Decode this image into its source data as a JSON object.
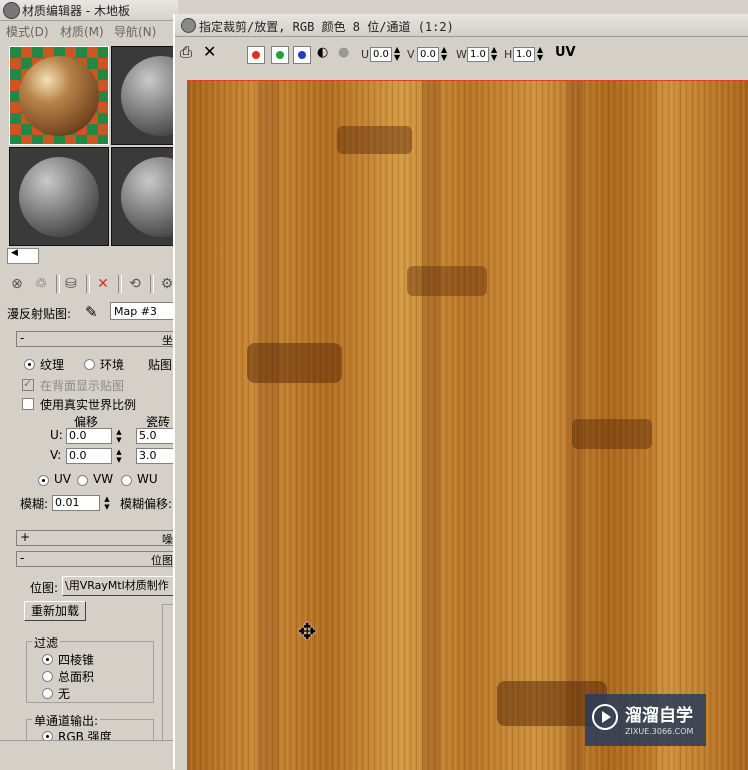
{
  "material_editor": {
    "title": "材质编辑器 - 木地板",
    "menu": [
      "模式(D)",
      "材质(M)",
      "导航(N)"
    ],
    "diffuse_label": "漫反射贴图:",
    "map_name": "Map #3",
    "coords_rollup_sign": "-",
    "coords_rollup_right": "坐",
    "radio_texture": "纹理",
    "radio_environ": "环境",
    "mapping_label": "贴图",
    "show_back_label": "在背面显示贴图",
    "real_world_label": "使用真实世界比例",
    "offset_header": "偏移",
    "tiling_header": "瓷砖",
    "u_label": "U:",
    "v_label": "V:",
    "u_offset": "0.0",
    "v_offset": "0.0",
    "u_tiling": "5.0",
    "v_tiling": "3.0",
    "uv_labels": [
      "UV",
      "VW",
      "WU"
    ],
    "blur_label": "模糊:",
    "blur_value": "0.01",
    "blur_offset_label": "模糊偏移:",
    "noise_rollup_sign": "+",
    "noise_rollup_right": "噪",
    "bitmap_rollup_sign": "-",
    "bitmap_rollup_right": "位图",
    "bitmap_label": "位图:",
    "bitmap_path": "\\用VRayMtl材质制作木",
    "reload_button": "重新加载",
    "filter_label": "过滤",
    "filter_options": [
      "四棱锥",
      "总面积",
      "无"
    ],
    "mono_label": "单通道输出:",
    "mono_first": "RGB 强度"
  },
  "viewer": {
    "title": "指定裁剪/放置, RGB 颜色 8 位/通道 (1:2)",
    "u_label": "U",
    "v_label": "V",
    "w_label": "W",
    "h_label": "H",
    "u_value": "0.0",
    "v_value": "0.0",
    "w_value": "1.0",
    "h_value": "1.0",
    "uv_button": "UV",
    "colors": {
      "red": "#e03020",
      "green": "#20a040",
      "blue": "#2040c0"
    }
  },
  "watermark": {
    "title": "溜溜自学",
    "url": "ZIXUE.3066.COM"
  }
}
